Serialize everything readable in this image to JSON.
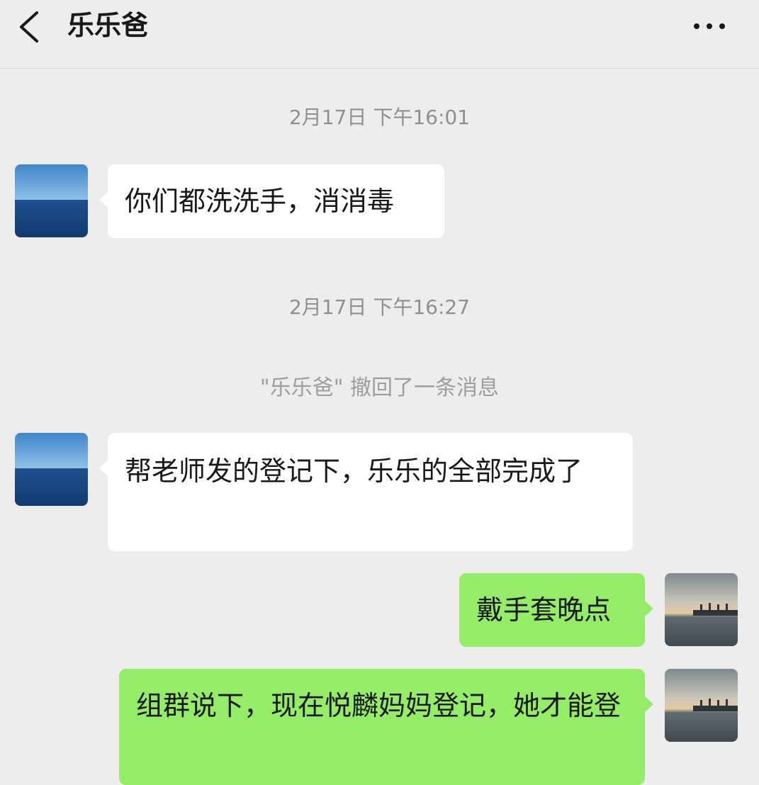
{
  "header": {
    "title": "乐乐爸",
    "back_icon": "chevron-left-icon",
    "more_icon": "more-dots-icon"
  },
  "messages": [
    {
      "type": "timestamp",
      "text": "2月17日 下午16:01"
    },
    {
      "type": "incoming",
      "text": "你们都洗洗手，消消毒",
      "avatar": "sea-horizon-avatar"
    },
    {
      "type": "timestamp",
      "text": "2月17日 下午16:27"
    },
    {
      "type": "system",
      "text": "\"乐乐爸\" 撤回了一条消息"
    },
    {
      "type": "incoming",
      "text": "帮老师发的登记下，乐乐的全部完成了",
      "avatar": "sea-horizon-avatar"
    },
    {
      "type": "outgoing",
      "text": "戴手套晚点",
      "avatar": "harbor-sunset-avatar"
    },
    {
      "type": "outgoing",
      "text": "组群说下，现在悦麟妈妈登记，她才能登",
      "avatar": "harbor-sunset-avatar"
    }
  ],
  "colors": {
    "background": "#ededed",
    "incoming_bubble": "#ffffff",
    "outgoing_bubble": "#95ec69",
    "timestamp_text": "#8f8f8f"
  }
}
